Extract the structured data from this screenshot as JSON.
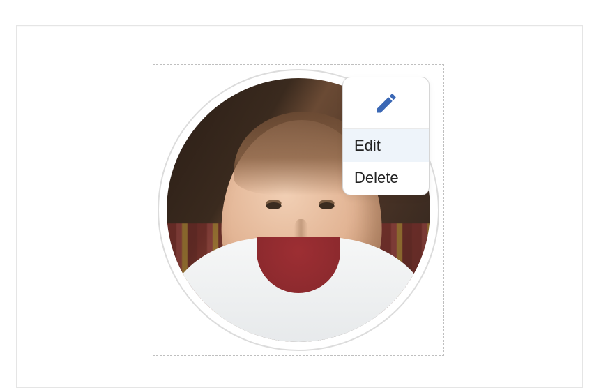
{
  "colors": {
    "accent": "#3b68b5"
  },
  "avatar_editor": {
    "popover": {
      "items": [
        {
          "label": "Edit"
        },
        {
          "label": "Delete"
        }
      ]
    }
  }
}
